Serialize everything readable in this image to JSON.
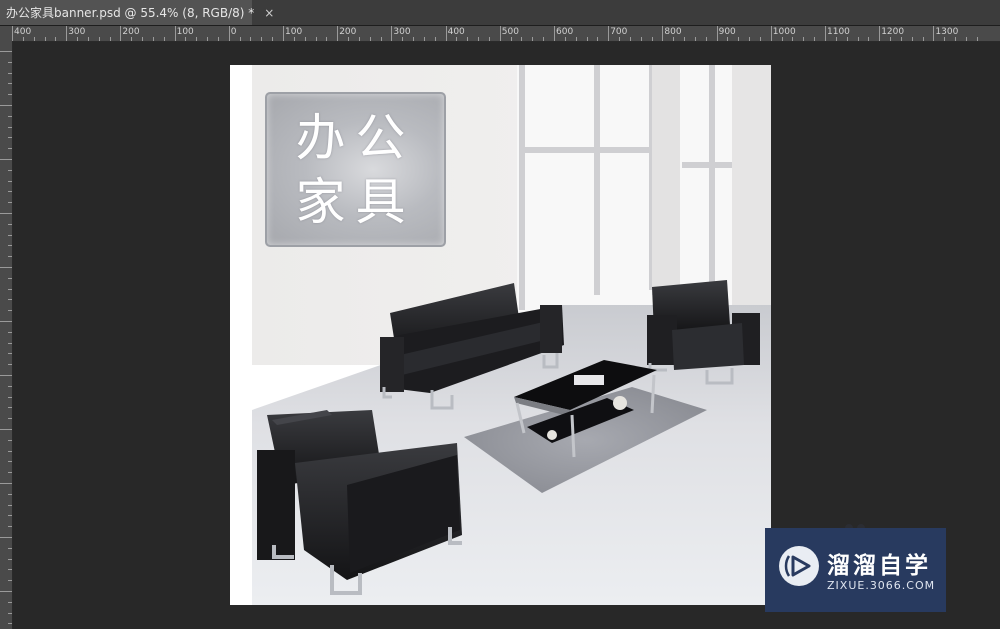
{
  "document_tab": {
    "title": "办公家具banner.psd @ 55.4% (8, RGB/8) *",
    "close_glyph": "×"
  },
  "ruler": {
    "top_labels": [
      "400",
      "300",
      "200",
      "100",
      "0",
      "100",
      "200",
      "300",
      "400",
      "500",
      "600",
      "700",
      "800",
      "900",
      "1000",
      "1100",
      "1200",
      "1300"
    ]
  },
  "canvas": {
    "title_line1": "办公",
    "title_line2": "家具",
    "scene": "office-furniture-photo"
  },
  "watermark": {
    "title": "溜溜自学",
    "subtitle": "ZIXUE.3066.COM",
    "brand_color": "#283a5f"
  }
}
